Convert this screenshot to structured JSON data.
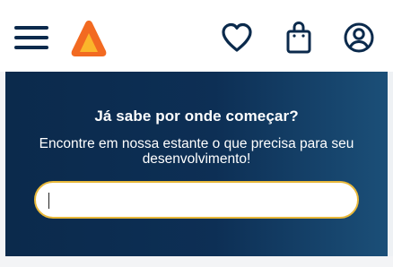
{
  "header": {
    "menu_icon": "hamburger-menu-icon",
    "logo_icon": "triangle-logo-icon",
    "favorites_icon": "heart-icon",
    "bag_icon": "shopping-bag-icon",
    "account_icon": "user-circle-icon"
  },
  "hero": {
    "title": "Já sabe por onde começar?",
    "subtitle": "Encontre em nossa estante o que precisa para seu desenvolvimento!",
    "search": {
      "value": "",
      "placeholder": ""
    }
  },
  "colors": {
    "icon_navy": "#0b2a4c",
    "hero_start": "#0b2a4c",
    "hero_end": "#1b4f78",
    "search_border": "#e8b83a",
    "logo_orange": "#f26a21",
    "logo_yellow": "#fbb62b"
  }
}
